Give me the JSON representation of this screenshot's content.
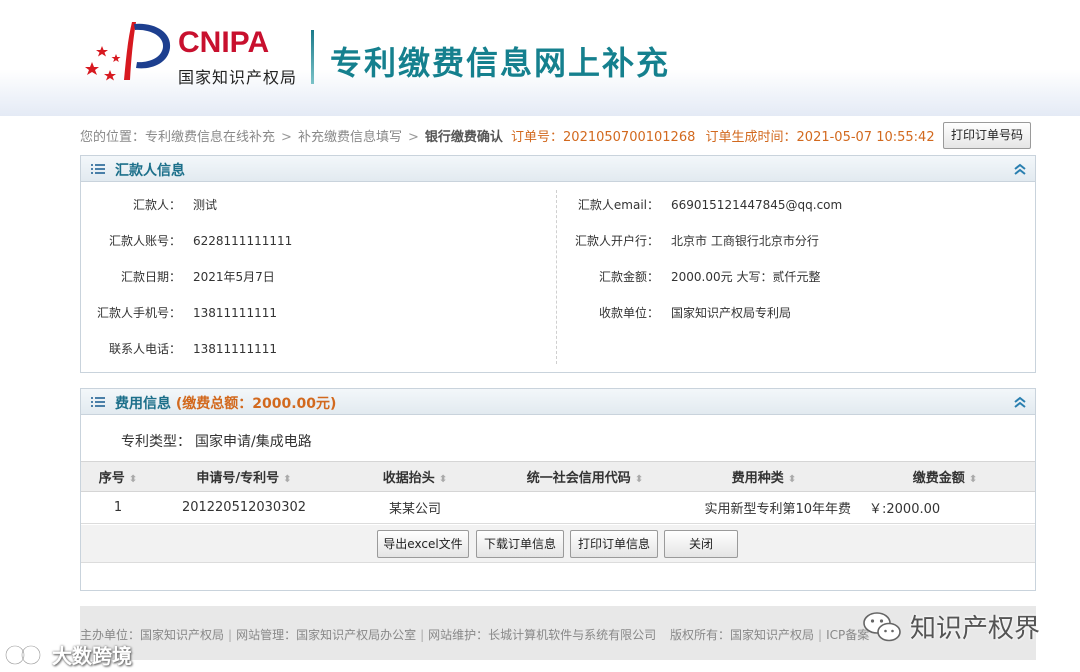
{
  "header": {
    "logo_text": "CNIPA",
    "logo_cn": "国家知识产权局",
    "system_title": "专利缴费信息网上补充"
  },
  "breadcrumb": {
    "prefix": "您的位置：",
    "items": [
      "专利缴费信息在线补充",
      "补充缴费信息填写",
      "银行缴费确认"
    ],
    "order_label": "订单号：",
    "order_no": "2021050700101268",
    "time_label": "订单生成时间：",
    "time_value": "2021-05-07 10:55:42"
  },
  "print_order_no_button": "打印订单号码",
  "remitter": {
    "title": "汇款人信息",
    "left": [
      {
        "label": "汇款人：",
        "value": "测试"
      },
      {
        "label": "汇款人账号：",
        "value": "6228111111111"
      },
      {
        "label": "汇款日期：",
        "value": "2021年5月7日"
      },
      {
        "label": "汇款人手机号：",
        "value": "13811111111"
      },
      {
        "label": "联系人电话：",
        "value": "13811111111"
      }
    ],
    "right": [
      {
        "label": "汇款人email：",
        "value": "669015121447845@qq.com"
      },
      {
        "label": "汇款人开户行：",
        "value": "北京市 工商银行北京市分行"
      },
      {
        "label": "汇款金额：",
        "value": "2000.00元 大写：贰仟元整"
      },
      {
        "label": "收款单位：",
        "value": "国家知识产权局专利局"
      }
    ]
  },
  "fee": {
    "title": "费用信息",
    "total": "(缴费总额：2000.00元)",
    "patent_type_label": "专利类型：",
    "patent_type_value": "国家申请/集成电路",
    "columns": [
      "序号",
      "申请号/专利号",
      "收据抬头",
      "统一社会信用代码",
      "费用种类",
      "缴费金额"
    ],
    "rows": [
      {
        "no": "1",
        "app_no": "201220512030302",
        "receipt_title": "某某公司",
        "credit_code": "",
        "fee_type": "实用新型专利第10年年费",
        "amount": "￥:2000.00"
      }
    ]
  },
  "buttons": {
    "export_excel": "导出excel文件",
    "download_order": "下载订单信息",
    "print_order": "打印订单信息",
    "close": "关闭"
  },
  "footer": {
    "host": "主办单位：国家知识产权局",
    "manage": "网站管理：国家知识产权局办公室",
    "maintain": "网站维护：长城计算机软件与系统有限公司",
    "copyright": "版权所有：国家知识产权局",
    "icp": "ICP备案"
  },
  "watermarks": {
    "right": "知识产权界",
    "left": "大数跨境"
  },
  "colors": {
    "brand_red": "#c8102e",
    "title_teal": "#15808e",
    "accent_orange": "#d2691e"
  }
}
